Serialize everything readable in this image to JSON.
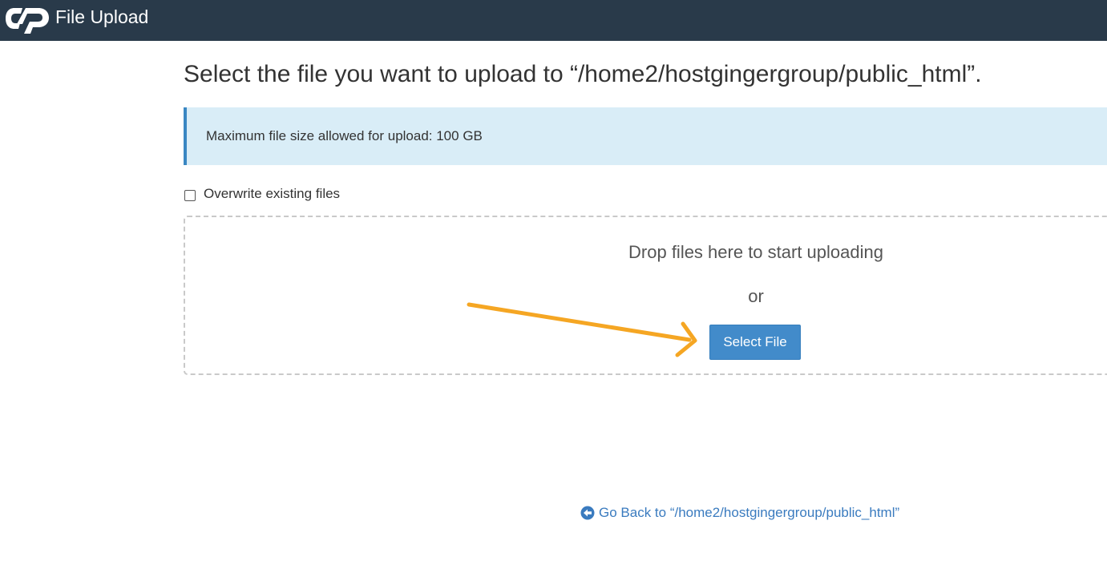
{
  "header": {
    "logo_icon": "cpanel-logo-icon",
    "title": "File Upload",
    "background": "#293a4a"
  },
  "main": {
    "heading": "Select the file you want to upload to “/home2/hostgingergroup/public_html”.",
    "info": {
      "text": "Maximum file size allowed for upload: 100 GB",
      "background": "#d9edf7",
      "accent": "#3a87c3"
    },
    "overwrite": {
      "label": "Overwrite existing files",
      "checked": false
    },
    "dropzone": {
      "drop_text": "Drop files here to start uploading",
      "or_text": "or",
      "select_button_label": "Select File",
      "button_color": "#428bca"
    },
    "annotation": {
      "icon": "arrow-annotation",
      "color": "#f5a623"
    },
    "go_back": {
      "icon": "arrow-circle-left-icon",
      "text": "Go Back to “/home2/hostgingergroup/public_html”",
      "color": "#3a7bbf"
    }
  }
}
